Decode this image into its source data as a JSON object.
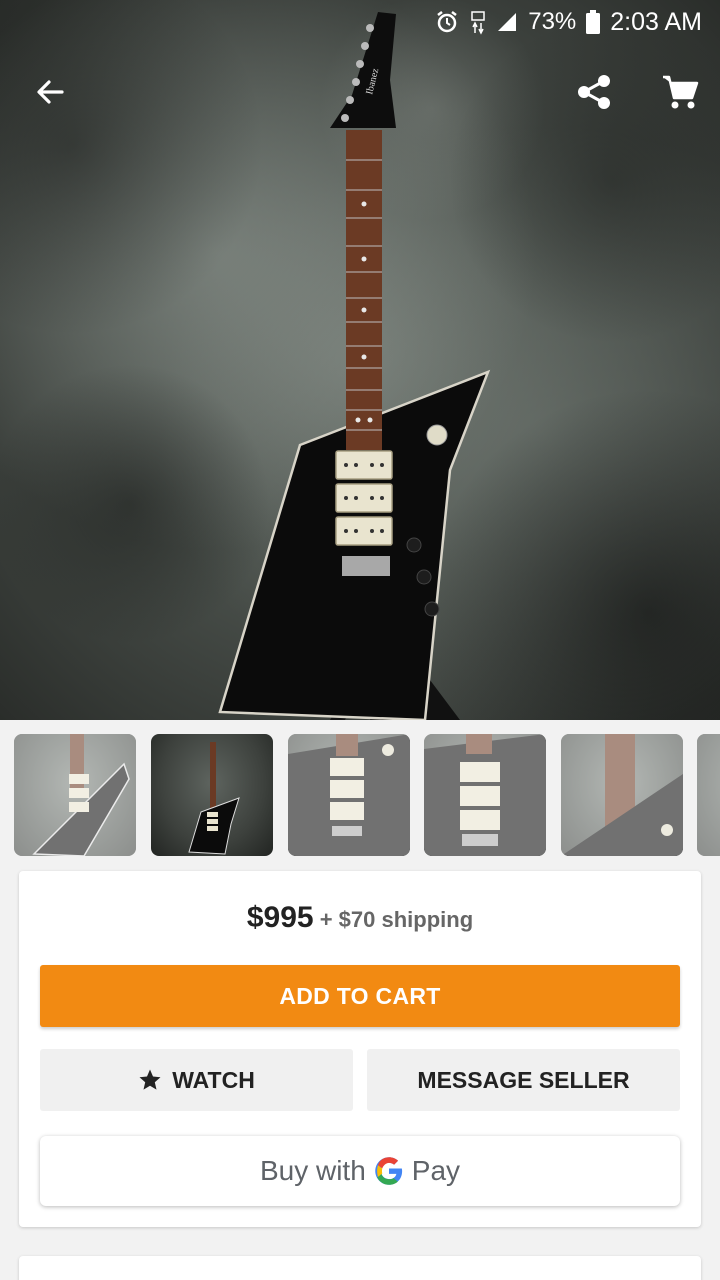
{
  "status_bar": {
    "battery": "73%",
    "time": "2:03 AM",
    "icons": [
      "alarm-icon",
      "network-type-icon",
      "signal-icon",
      "battery-icon"
    ]
  },
  "nav": {
    "back_icon": "arrow-back-icon",
    "share_icon": "share-icon",
    "cart_icon": "cart-icon"
  },
  "hero": {
    "headstock_brand": "Ibanez"
  },
  "thumbnails": [
    {
      "state": "dim"
    },
    {
      "state": "selected"
    },
    {
      "state": "dim"
    },
    {
      "state": "dim"
    },
    {
      "state": "dim"
    },
    {
      "state": "dim"
    }
  ],
  "purchase": {
    "price": "$995",
    "shipping": "+ $70 shipping",
    "add_to_cart_label": "ADD TO CART",
    "watch_label": "WATCH",
    "message_seller_label": "MESSAGE SELLER",
    "gpay_prefix": "Buy with",
    "gpay_suffix": "Pay"
  },
  "colors": {
    "accent": "#f28a12",
    "button_gray": "#f0f0f0",
    "background": "#f2f2f2"
  }
}
